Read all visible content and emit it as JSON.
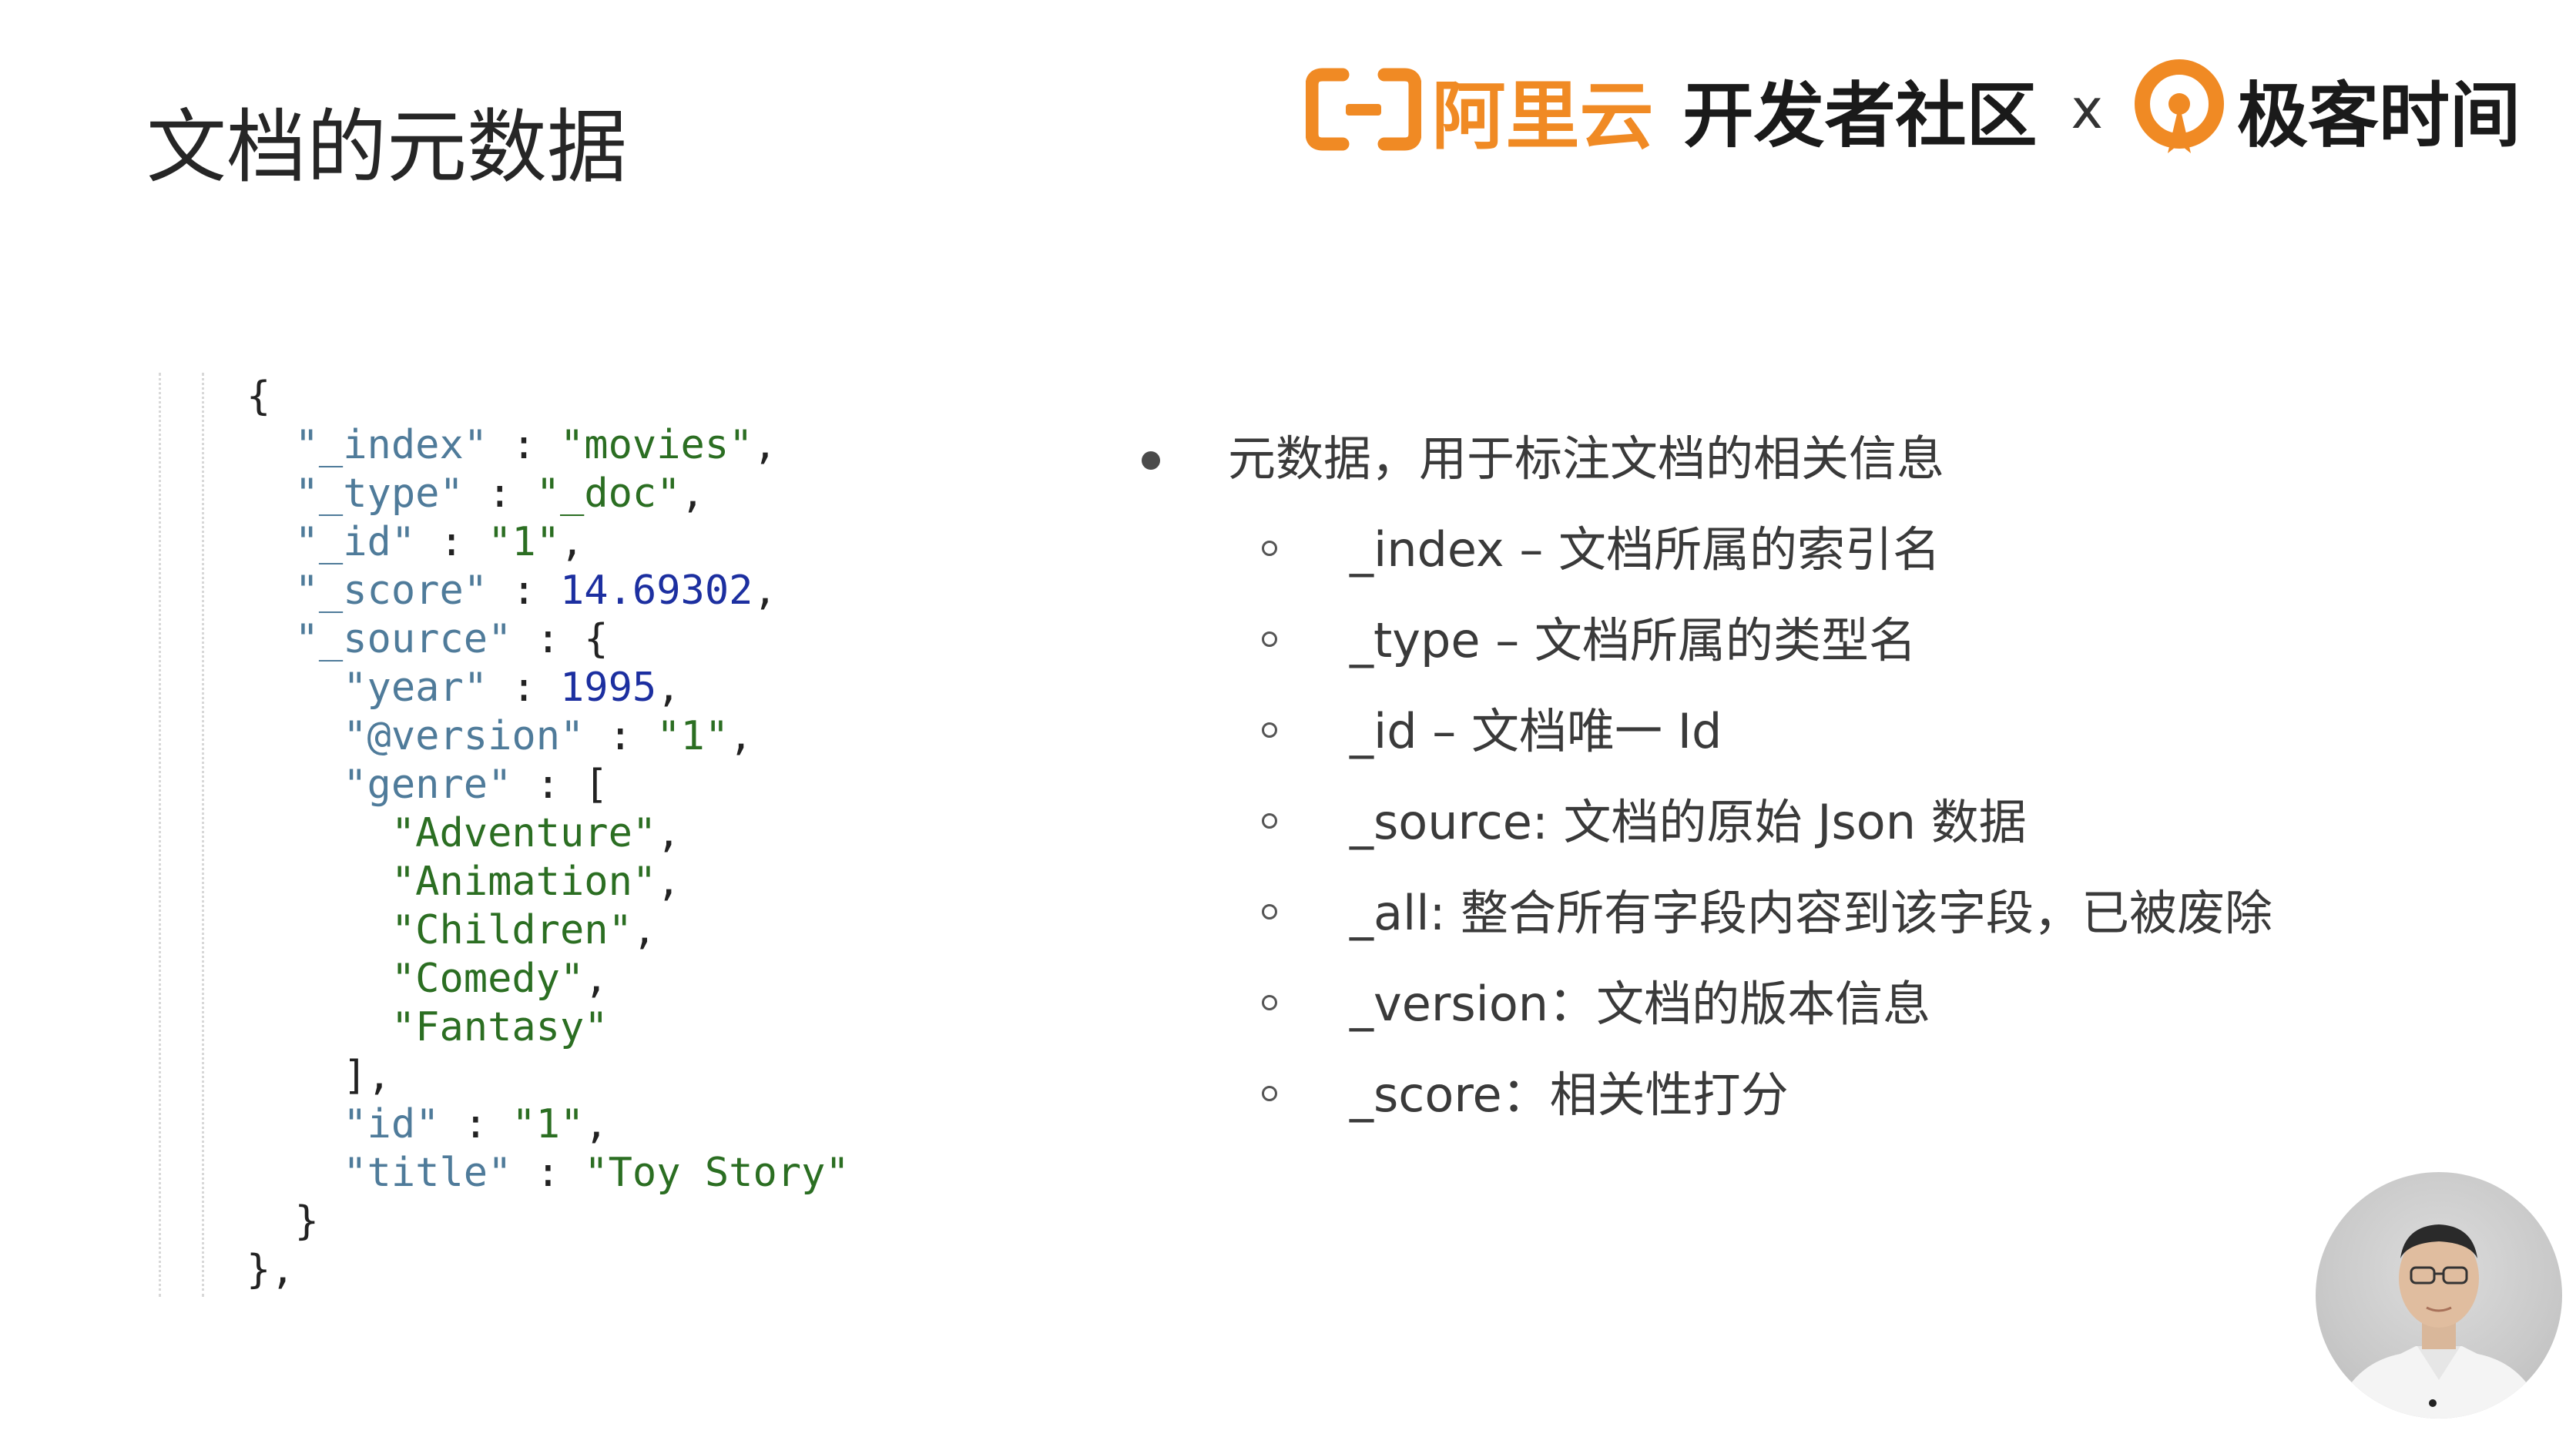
{
  "slide": {
    "title": "文档的元数据"
  },
  "header": {
    "aliyun_text": "阿里云",
    "devcommunity_text": "开发者社区",
    "cross_sign": "x",
    "geektime_text": "极客时间"
  },
  "code": {
    "lines": [
      [
        {
          "t": "p",
          "v": "{"
        }
      ],
      [
        {
          "t": "p",
          "v": "  "
        },
        {
          "t": "k",
          "v": "\"_index\""
        },
        {
          "t": "p",
          "v": " : "
        },
        {
          "t": "s",
          "v": "\"movies\""
        },
        {
          "t": "p",
          "v": ","
        }
      ],
      [
        {
          "t": "p",
          "v": "  "
        },
        {
          "t": "k",
          "v": "\"_type\""
        },
        {
          "t": "p",
          "v": " : "
        },
        {
          "t": "s",
          "v": "\"_doc\""
        },
        {
          "t": "p",
          "v": ","
        }
      ],
      [
        {
          "t": "p",
          "v": "  "
        },
        {
          "t": "k",
          "v": "\"_id\""
        },
        {
          "t": "p",
          "v": " : "
        },
        {
          "t": "s",
          "v": "\"1\""
        },
        {
          "t": "p",
          "v": ","
        }
      ],
      [
        {
          "t": "p",
          "v": "  "
        },
        {
          "t": "k",
          "v": "\"_score\""
        },
        {
          "t": "p",
          "v": " : "
        },
        {
          "t": "n",
          "v": "14.69302"
        },
        {
          "t": "p",
          "v": ","
        }
      ],
      [
        {
          "t": "p",
          "v": "  "
        },
        {
          "t": "k",
          "v": "\"_source\""
        },
        {
          "t": "p",
          "v": " : {"
        }
      ],
      [
        {
          "t": "p",
          "v": "    "
        },
        {
          "t": "k",
          "v": "\"year\""
        },
        {
          "t": "p",
          "v": " : "
        },
        {
          "t": "n",
          "v": "1995"
        },
        {
          "t": "p",
          "v": ","
        }
      ],
      [
        {
          "t": "p",
          "v": "    "
        },
        {
          "t": "k",
          "v": "\"@version\""
        },
        {
          "t": "p",
          "v": " : "
        },
        {
          "t": "s",
          "v": "\"1\""
        },
        {
          "t": "p",
          "v": ","
        }
      ],
      [
        {
          "t": "p",
          "v": "    "
        },
        {
          "t": "k",
          "v": "\"genre\""
        },
        {
          "t": "p",
          "v": " : ["
        }
      ],
      [
        {
          "t": "p",
          "v": "      "
        },
        {
          "t": "s",
          "v": "\"Adventure\""
        },
        {
          "t": "p",
          "v": ","
        }
      ],
      [
        {
          "t": "p",
          "v": "      "
        },
        {
          "t": "s",
          "v": "\"Animation\""
        },
        {
          "t": "p",
          "v": ","
        }
      ],
      [
        {
          "t": "p",
          "v": "      "
        },
        {
          "t": "s",
          "v": "\"Children\""
        },
        {
          "t": "p",
          "v": ","
        }
      ],
      [
        {
          "t": "p",
          "v": "      "
        },
        {
          "t": "s",
          "v": "\"Comedy\""
        },
        {
          "t": "p",
          "v": ","
        }
      ],
      [
        {
          "t": "p",
          "v": "      "
        },
        {
          "t": "s",
          "v": "\"Fantasy\""
        }
      ],
      [
        {
          "t": "p",
          "v": "    ],"
        }
      ],
      [
        {
          "t": "p",
          "v": "    "
        },
        {
          "t": "k",
          "v": "\"id\""
        },
        {
          "t": "p",
          "v": " : "
        },
        {
          "t": "s",
          "v": "\"1\""
        },
        {
          "t": "p",
          "v": ","
        }
      ],
      [
        {
          "t": "p",
          "v": "    "
        },
        {
          "t": "k",
          "v": "\"title\""
        },
        {
          "t": "p",
          "v": " : "
        },
        {
          "t": "s",
          "v": "\"Toy Story\""
        }
      ],
      [
        {
          "t": "p",
          "v": "  }"
        }
      ],
      [
        {
          "t": "p",
          "v": "},"
        }
      ]
    ]
  },
  "bullets": {
    "main": "元数据，用于标注文档的相关信息",
    "items": [
      "_index – 文档所属的索引名",
      "_type – 文档所属的类型名",
      "_id – 文档唯一 Id",
      "_source: 文档的原始 Json 数据",
      "_all: 整合所有字段内容到该字段，已被废除",
      "_version：文档的版本信息",
      "_score：相关性打分"
    ]
  },
  "colors": {
    "aliyun_orange": "#f08a24",
    "geektime_orange": "#f08a24",
    "code_key": "#4f7b9a",
    "code_string": "#2b6e22",
    "code_number": "#1c2fa0"
  },
  "icons": {
    "aliyun_logo": "aliyun-bracket-icon",
    "geektime_logo": "geektime-ring-icon"
  }
}
